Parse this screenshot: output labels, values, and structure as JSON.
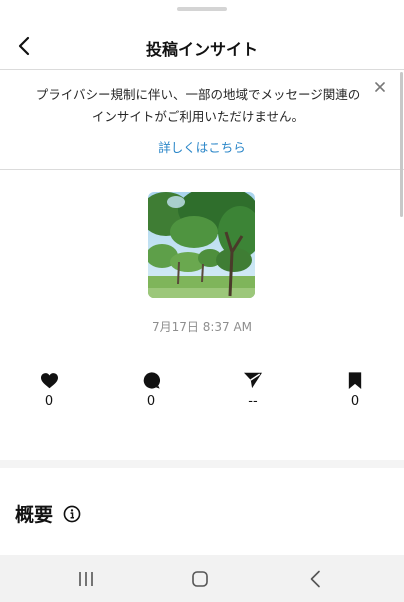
{
  "header": {
    "title": "投稿インサイト",
    "back_icon": "chevron-left-icon"
  },
  "notice": {
    "text": "プライバシー規制に伴い、一部の地域でメッセージ関連のインサイトがご利用いただけません。",
    "link": "詳しくはこちら",
    "close_icon": "close-icon"
  },
  "post": {
    "thumbnail": "park-trees-photo",
    "date": "7月17日 8:37 AM"
  },
  "stats": [
    {
      "icon": "heart-icon",
      "value": "0"
    },
    {
      "icon": "comment-icon",
      "value": "0"
    },
    {
      "icon": "send-icon",
      "value": "--"
    },
    {
      "icon": "bookmark-icon",
      "value": "0"
    }
  ],
  "overview": {
    "title": "概要",
    "info_icon": "info-icon"
  },
  "navbar": {
    "recents_icon": "recents-icon",
    "home_icon": "home-icon",
    "back_icon": "back-icon"
  },
  "colors": {
    "link": "#2a86c8",
    "secondary_text": "#8e8e8e",
    "divider": "#dbdbdb",
    "nav_background": "#f2f2f2"
  }
}
